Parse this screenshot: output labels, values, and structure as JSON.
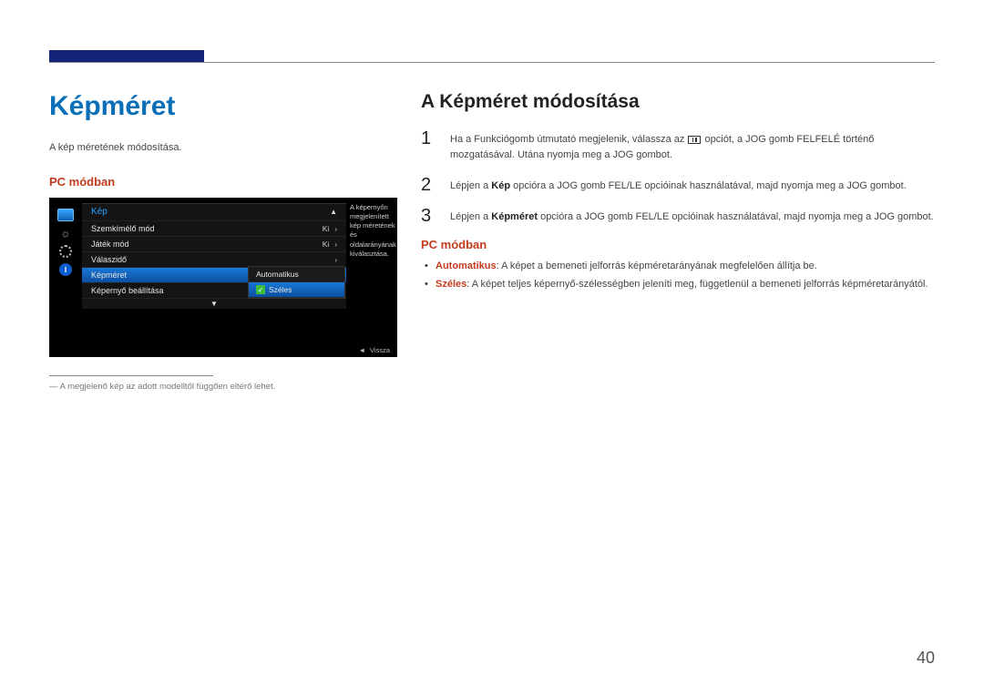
{
  "accent_color": "#0b6fb8",
  "red_color": "#c33c1d",
  "page_number": "40",
  "left": {
    "title": "Képméret",
    "intro": "A kép méretének módosítása.",
    "subheading": "PC módban",
    "footnote_prefix": "―",
    "footnote": "A megjelenő kép az adott modelltől függően eltérő lehet."
  },
  "osd": {
    "menu_title": "Kép",
    "rows": [
      {
        "label": "Szemkímélő mód",
        "value": "Ki",
        "selected": false
      },
      {
        "label": "Játék mód",
        "value": "Ki",
        "selected": false
      },
      {
        "label": "Válaszidő",
        "value": "",
        "selected": false
      },
      {
        "label": "Képméret",
        "value": "",
        "selected": true
      },
      {
        "label": "Képernyő beállítása",
        "value": "",
        "selected": false
      }
    ],
    "submenu": [
      {
        "label": "Automatikus",
        "selected": false,
        "checked": false
      },
      {
        "label": "Széles",
        "selected": true,
        "checked": true
      }
    ],
    "description": "A képernyőn megjelenített kép méretének és oldalarányának kiválasztása.",
    "footer_back": "Vissza"
  },
  "right": {
    "title": "A Képméret módosítása",
    "steps": {
      "s1_a": "Ha a Funkciógomb útmutató megjelenik, válassza az ",
      "s1_b": " opciót, a JOG gomb FELFELÉ történő mozgatásával. Utána nyomja meg a JOG gombot.",
      "s2_a": "Lépjen a ",
      "s2_kw": "Kép",
      "s2_b": " opcióra a JOG gomb FEL/LE opcióinak használatával, majd nyomja meg a JOG gombot.",
      "s3_a": "Lépjen a ",
      "s3_kw": "Képméret",
      "s3_b": " opcióra a JOG gomb FEL/LE opcióinak használatával, majd nyomja meg a JOG gombot."
    },
    "subheading": "PC módban",
    "options": {
      "o1_name": "Automatikus",
      "o1_desc": ": A képet a bemeneti jelforrás képméretarányának megfelelően állítja be.",
      "o2_name": "Széles",
      "o2_desc": ": A képet teljes képernyő-szélességben jeleníti meg, függetlenül a bemeneti jelforrás képméretarányától."
    }
  }
}
